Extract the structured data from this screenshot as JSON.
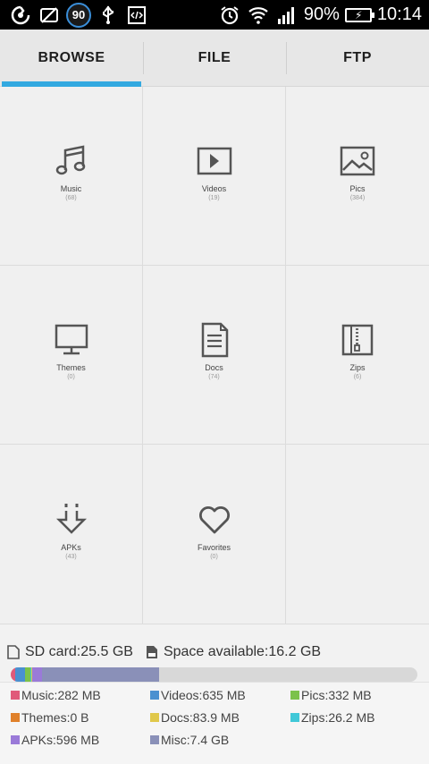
{
  "status_bar": {
    "badge": "90",
    "battery": "90%",
    "time": "10:14"
  },
  "tabs": [
    {
      "label": "BROWSE",
      "active": true
    },
    {
      "label": "FILE",
      "active": false
    },
    {
      "label": "FTP",
      "active": false
    }
  ],
  "categories": [
    {
      "label": "Music",
      "count": "(68)",
      "icon": "music-icon"
    },
    {
      "label": "Videos",
      "count": "(19)",
      "icon": "video-icon"
    },
    {
      "label": "Pics",
      "count": "(384)",
      "icon": "picture-icon"
    },
    {
      "label": "Themes",
      "count": "(0)",
      "icon": "monitor-icon"
    },
    {
      "label": "Docs",
      "count": "(74)",
      "icon": "document-icon"
    },
    {
      "label": "Zips",
      "count": "(6)",
      "icon": "zip-icon"
    },
    {
      "label": "APKs",
      "count": "(43)",
      "icon": "apk-download-icon"
    },
    {
      "label": "Favorites",
      "count": "(0)",
      "icon": "heart-icon"
    }
  ],
  "storage": {
    "sd_card": "SD card:25.5 GB",
    "space_available": "Space available:16.2 GB"
  },
  "usage": {
    "segments": [
      {
        "name": "Music",
        "fraction": 0.011,
        "color": "#e05a7a"
      },
      {
        "name": "Videos",
        "fraction": 0.024,
        "color": "#4a90d0"
      },
      {
        "name": "Pics",
        "fraction": 0.013,
        "color": "#7cc24a"
      },
      {
        "name": "Zips",
        "fraction": 0.002,
        "color": "#40c8d8"
      },
      {
        "name": "Docs",
        "fraction": 0.003,
        "color": "#e0c84a"
      },
      {
        "name": "APKs",
        "fraction": 0.023,
        "color": "#9a7ad8"
      },
      {
        "name": "Misc",
        "fraction": 0.29,
        "color": "#8a90b8"
      }
    ]
  },
  "legend": [
    {
      "text": "Music:282 MB",
      "color": "#e05a7a"
    },
    {
      "text": "Videos:635 MB",
      "color": "#4a90d0"
    },
    {
      "text": "Pics:332 MB",
      "color": "#7cc24a"
    },
    {
      "text": "Themes:0 B",
      "color": "#e0802a"
    },
    {
      "text": "Docs:83.9 MB",
      "color": "#e0c84a"
    },
    {
      "text": "Zips:26.2 MB",
      "color": "#40c8d8"
    },
    {
      "text": "APKs:596 MB",
      "color": "#9a7ad8"
    },
    {
      "text": "Misc:7.4 GB",
      "color": "#8a90b8"
    }
  ]
}
